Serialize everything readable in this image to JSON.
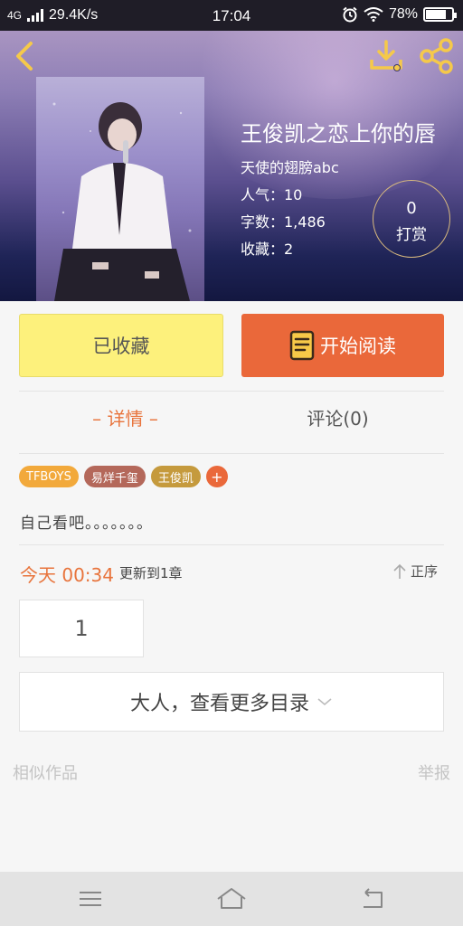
{
  "status_bar": {
    "network": "4G",
    "speed": "29.4K/s",
    "time": "17:04",
    "battery": "78%",
    "battery_level": 0.78
  },
  "header": {
    "back_icon": "chevron-left-icon",
    "download_icon": "download-icon",
    "share_icon": "share-icon"
  },
  "book": {
    "title": "王俊凯之恋上你的唇",
    "author": "天使的翅膀abc",
    "popularity": "人气：10",
    "word_count": "字数：1,486",
    "favorites": "收藏：2",
    "reward_count": "0",
    "reward_label": "打赏"
  },
  "actions": {
    "favorited_label": "已收藏",
    "start_reading_label": "开始阅读"
  },
  "tabs": {
    "detail": "– 详情 –",
    "comments": "评论(0)"
  },
  "tags": [
    {
      "label": "TFBOYS",
      "color": "#f2a93b"
    },
    {
      "label": "易烊千玺",
      "color": "#b4685a"
    },
    {
      "label": "王俊凯",
      "color": "#c59a3d"
    }
  ],
  "tag_add": "+",
  "intro": "自己看吧。。。。。。。",
  "update": {
    "date": "今天 00:34",
    "text": "更新到1章",
    "sort_label": "正序"
  },
  "chapter_box": "1",
  "more_toc": "大人，查看更多目录",
  "footer": {
    "similar": "相似作品",
    "report": "举报"
  },
  "colors": {
    "accent": "#ea683a",
    "favorite": "#fdf17c",
    "icon_gold": "#f5c94a"
  }
}
